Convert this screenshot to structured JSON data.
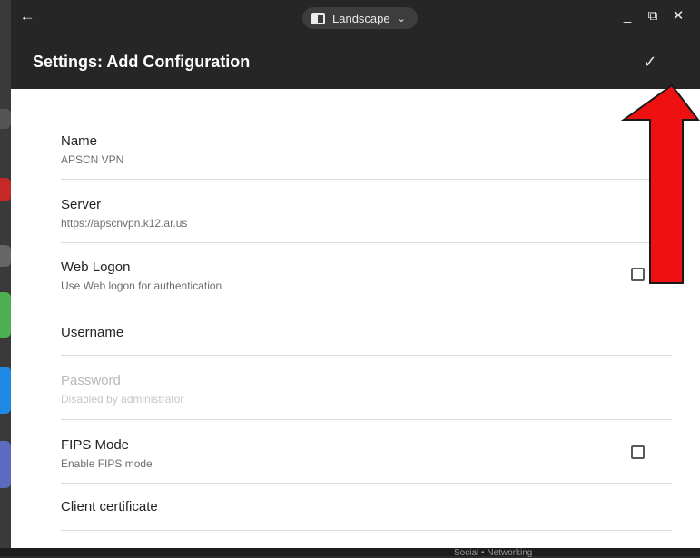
{
  "window": {
    "mode_label": "Landscape"
  },
  "app_bar": {
    "title": "Settings: Add Configuration"
  },
  "settings": {
    "name": {
      "title": "Name",
      "value": "APSCN VPN"
    },
    "server": {
      "title": "Server",
      "value": "https://apscnvpn.k12.ar.us"
    },
    "web_logon": {
      "title": "Web Logon",
      "subtitle": "Use Web logon for authentication",
      "checked": false
    },
    "username": {
      "title": "Username"
    },
    "password": {
      "title": "Password",
      "subtitle": "Disabled by administrator"
    },
    "fips_mode": {
      "title": "FIPS Mode",
      "subtitle": "Enable FIPS mode",
      "checked": false
    },
    "client_certificate": {
      "title": "Client certificate"
    }
  },
  "background": {
    "bottom_text": "Social • Networking"
  },
  "colors": {
    "bar": "#262626",
    "annotation_arrow": "#ee1111",
    "arrow_outline": "#1a1a1a"
  },
  "icons": {
    "back": "arrow-left-icon",
    "mode": "tablet-icon",
    "minimize": "minimize-icon",
    "restore": "restore-icon",
    "close": "close-icon",
    "confirm": "checkmark-icon"
  }
}
